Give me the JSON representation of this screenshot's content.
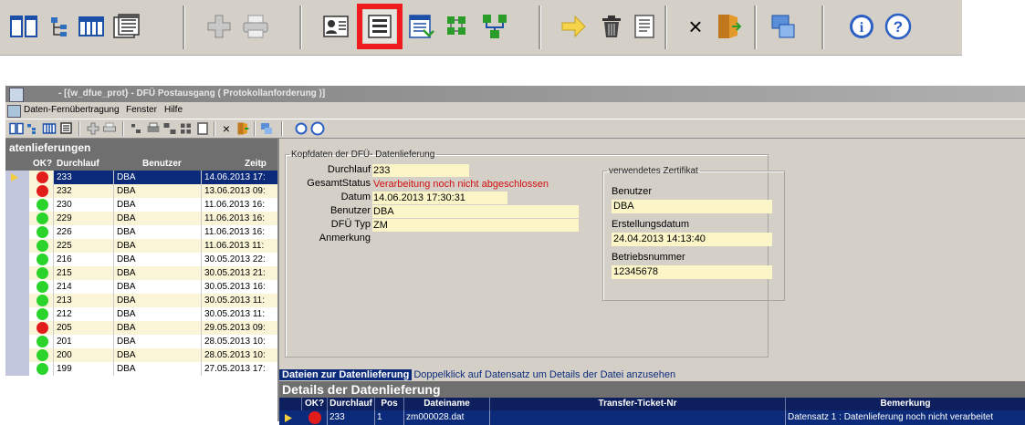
{
  "big_toolbar": {
    "icons": [
      "split-view-icon",
      "tree-view-icon",
      "columns-view-icon",
      "report-list-icon",
      "add-icon",
      "print-icon",
      "address-card-icon",
      "details-form-icon",
      "export-icon",
      "grid-icon",
      "relations-icon",
      "arrow-right-icon",
      "delete-icon",
      "document-icon",
      "close-icon",
      "exit-door-icon",
      "network-icon",
      "info-icon",
      "help-icon"
    ],
    "close_glyph": "×",
    "info_glyph": "i",
    "help_glyph": "?"
  },
  "window": {
    "title": "- [{w_dfue_prot} - DFÜ Postausgang ( Protokollanforderung )]",
    "menu": [
      "Daten-Fernübertragung",
      "Fenster",
      "Hilfe"
    ]
  },
  "left": {
    "title": "atenlieferungen",
    "columns": [
      "OK?",
      "Durchlauf",
      "Benutzer",
      "Zeitp"
    ],
    "rows": [
      {
        "status": "red",
        "id": "233",
        "user": "DBA",
        "time": "14.06.2013 17:",
        "selected": true
      },
      {
        "status": "red",
        "id": "232",
        "user": "DBA",
        "time": "13.06.2013 09:"
      },
      {
        "status": "green",
        "id": "230",
        "user": "DBA",
        "time": "11.06.2013 16:"
      },
      {
        "status": "green",
        "id": "229",
        "user": "DBA",
        "time": "11.06.2013 16:"
      },
      {
        "status": "green",
        "id": "226",
        "user": "DBA",
        "time": "11.06.2013 16:"
      },
      {
        "status": "green",
        "id": "225",
        "user": "DBA",
        "time": "11.06.2013 11:"
      },
      {
        "status": "green",
        "id": "216",
        "user": "DBA",
        "time": "30.05.2013 22:"
      },
      {
        "status": "green",
        "id": "215",
        "user": "DBA",
        "time": "30.05.2013 21:"
      },
      {
        "status": "green",
        "id": "214",
        "user": "DBA",
        "time": "30.05.2013 16:"
      },
      {
        "status": "green",
        "id": "213",
        "user": "DBA",
        "time": "30.05.2013 11:"
      },
      {
        "status": "green",
        "id": "212",
        "user": "DBA",
        "time": "30.05.2013 11:"
      },
      {
        "status": "red",
        "id": "205",
        "user": "DBA",
        "time": "29.05.2013 09:"
      },
      {
        "status": "green",
        "id": "201",
        "user": "DBA",
        "time": "28.05.2013 10:"
      },
      {
        "status": "green",
        "id": "200",
        "user": "DBA",
        "time": "28.05.2013 10:"
      },
      {
        "status": "green",
        "id": "199",
        "user": "DBA",
        "time": "27.05.2013 17:"
      }
    ]
  },
  "header": {
    "legend": "Kopfdaten der DFÜ- Datenlieferung",
    "durchlauf_label": "Durchlauf",
    "durchlauf_value": "233",
    "status_label": "GesamtStatus",
    "status_value": "Verarbeitung noch nicht abgeschlossen",
    "datum_label": "Datum",
    "datum_value": "14.06.2013 17:30:31",
    "benutzer_label": "Benutzer",
    "benutzer_value": "DBA",
    "typ_label": "DFÜ Typ",
    "typ_value": "ZM",
    "anmerkung_label": "Anmerkung"
  },
  "certificate": {
    "legend": "verwendetes Zertifikat",
    "benutzer_label": "Benutzer",
    "benutzer_value": "DBA",
    "datum_label": "Erstellungsdatum",
    "datum_value": "24.04.2013 14:13:40",
    "betrieb_label": "Betriebsnummer",
    "betrieb_value": "12345678"
  },
  "files": {
    "tab_label": "Dateien zur Datenlieferung",
    "hint": "Doppelklick auf Datensatz um Details der Datei anzusehen",
    "details_title": "Details der Datenlieferung",
    "columns": [
      "OK?",
      "Durchlauf",
      "Pos",
      "Dateiname",
      "Transfer-Ticket-Nr",
      "Bemerkung"
    ],
    "row": {
      "status": "red",
      "durchlauf": "233",
      "pos": "1",
      "dateiname": "zm000028.dat",
      "ticket": "",
      "bemerkung": "Datensatz 1 : Datenlieferung noch nicht verarbeitet"
    }
  },
  "colors": {
    "selected_navy": "#0b2a7a",
    "status_red": "#e21b1b",
    "status_green": "#2bd42b",
    "highlight_border": "#ee1c1c"
  }
}
